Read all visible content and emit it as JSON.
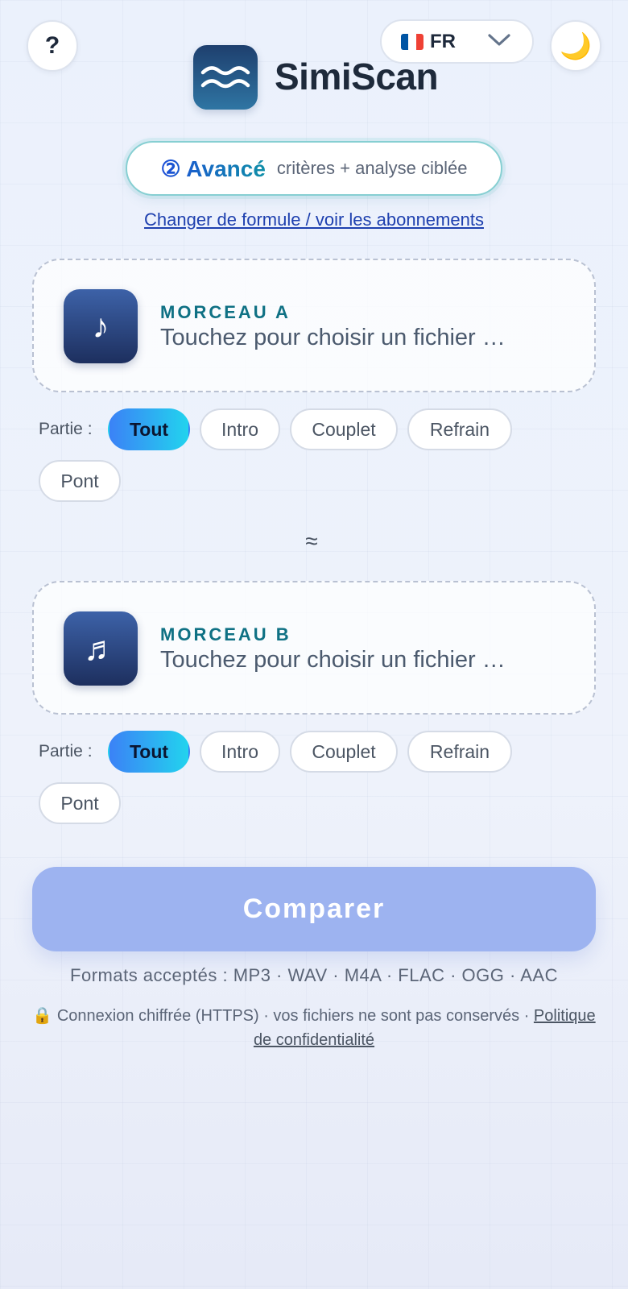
{
  "header": {
    "help_label": "?",
    "language_code": "FR",
    "theme_icon": "🌙",
    "app_name": "SimiScan"
  },
  "plan": {
    "name": "② Avancé",
    "description": "critères + analyse ciblée",
    "change_link": "Changer de formule / voir les abonnements"
  },
  "tracks": [
    {
      "label": "MORCEAU A",
      "hint": "Touchez pour choisir un fichier …",
      "icon": "♪",
      "parts_label": "Partie :",
      "parts": [
        "Tout",
        "Intro",
        "Couplet",
        "Refrain",
        "Pont"
      ],
      "selected_part": "Tout"
    },
    {
      "label": "MORCEAU B",
      "hint": "Touchez pour choisir un fichier …",
      "icon": "♬",
      "parts_label": "Partie :",
      "parts": [
        "Tout",
        "Intro",
        "Couplet",
        "Refrain",
        "Pont"
      ],
      "selected_part": "Tout"
    }
  ],
  "separator": "≈",
  "compare_label": "Comparer",
  "formats": "Formats acceptés : MP3 · WAV · M4A · FLAC · OGG · AAC",
  "security": {
    "text": "🔒 Connexion chiffrée (HTTPS) · vos fichiers ne sont pas conservés · ",
    "policy_link": "Politique de confidentialité"
  },
  "colors": {
    "accent_gradient_start": "#3b82f6",
    "accent_gradient_end": "#22d3ee",
    "compare_button": "#9db3f0",
    "track_label": "#0f7184"
  }
}
